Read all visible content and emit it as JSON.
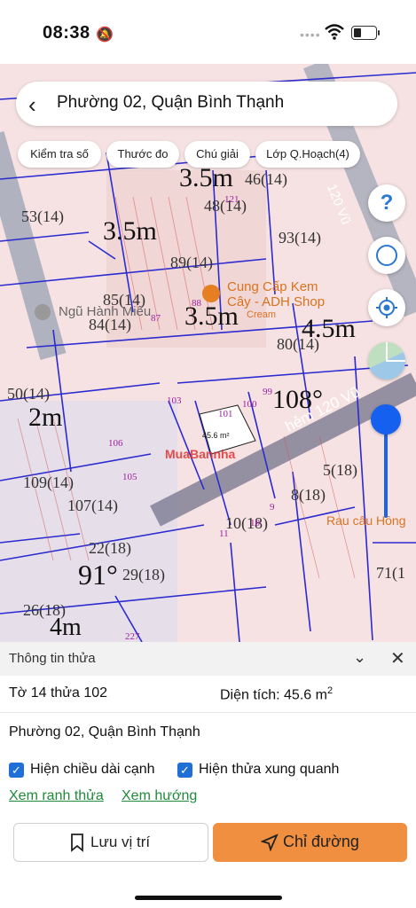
{
  "status_bar": {
    "time": "08:38"
  },
  "header": {
    "title": "Phường 02, Quận Bình Thạnh"
  },
  "chips": [
    "Kiểm tra số",
    "Thước đo",
    "Chú giải",
    "Lớp Q.Hoạch(4)"
  ],
  "map": {
    "poi_1": "Ngũ Hành Miếu",
    "poi_2": "Cung Cấp Kem",
    "poi_3": "Cây - ADH Shop",
    "poi_4": "Cream",
    "poi_5": "Rau câu Hồng",
    "street_1": "hẻm 120 Vũ",
    "street_2": "120 Vũ",
    "selected_area": "45.6 m²",
    "watermark": "MuaBannha",
    "dims": [
      "3.5m",
      "3.5m",
      "3.5m",
      "4.5m",
      "2m",
      "4m",
      "91°",
      "108°"
    ],
    "parcels": [
      "46(14)",
      "48(14)",
      "93(14)",
      "89(14)",
      "85(14)",
      "84(14)",
      "53(14)",
      "50(14)",
      "80(14)",
      "109(14)",
      "107(14)",
      "22(18)",
      "29(18)",
      "26(18)",
      "71(1",
      "5(18)",
      "8(18)",
      "10(18)",
      "121",
      "87",
      "88",
      "103",
      "101",
      "100",
      "99",
      "106",
      "105",
      "9",
      "11",
      "10",
      "227"
    ]
  },
  "sheet": {
    "title": "Thông tin thửa",
    "sheet_info": "Tờ 14 thửa 102",
    "area_label": "Diện tích: 45.6 m",
    "area_sup": "2",
    "address": "Phường 02, Quận Bình Thạnh",
    "cb1": "Hiện chiều dài cạnh",
    "cb2": "Hiện thửa xung quanh",
    "link1": "Xem ranh thửa",
    "link2": "Xem hướng",
    "save_btn": "Lưu vị trí",
    "route_btn": "Chỉ đường"
  },
  "colors": {
    "accent": "#ef8f3f",
    "link": "#1e8a3a",
    "checkbox": "#1f6fd6",
    "map_lines": "#2b2bd0"
  },
  "icons": [
    "back-chevron-icon",
    "help-icon",
    "compass-icon",
    "locate-icon",
    "bookmark-icon",
    "navigate-icon",
    "chevron-down-icon",
    "close-icon"
  ]
}
